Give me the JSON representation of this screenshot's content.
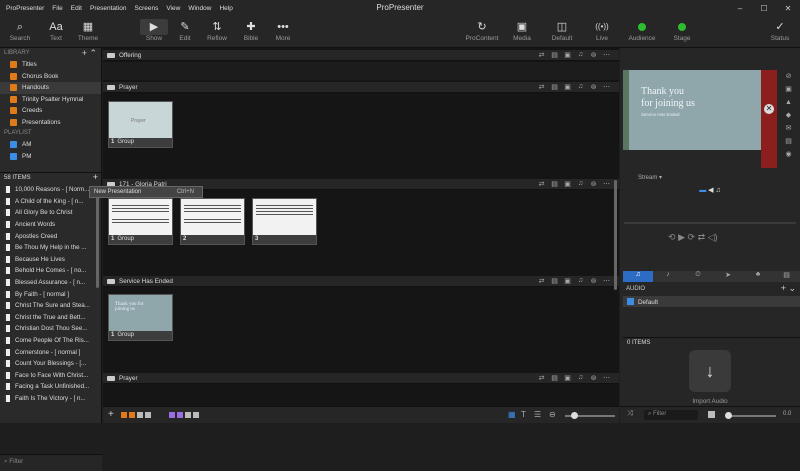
{
  "app": {
    "title": "ProPresenter",
    "menu": [
      "ProPresenter",
      "File",
      "Edit",
      "Presentation",
      "Screens",
      "View",
      "Window",
      "Help"
    ],
    "window_controls": [
      "–",
      "☐",
      "✕"
    ]
  },
  "toolbar": {
    "left": [
      {
        "label": "Search",
        "icon": "search-icon",
        "glyph": "⌕"
      },
      {
        "label": "Text",
        "icon": "text-icon",
        "glyph": "Aa"
      },
      {
        "label": "Theme",
        "icon": "theme-icon",
        "glyph": "▦"
      }
    ],
    "middle": [
      {
        "label": "Show",
        "icon": "show-icon",
        "glyph": "▶"
      },
      {
        "label": "Edit",
        "icon": "edit-icon",
        "glyph": "✎"
      },
      {
        "label": "Reflow",
        "icon": "reflow-icon",
        "glyph": "⇅"
      },
      {
        "label": "Bible",
        "icon": "bible-icon",
        "glyph": "✚"
      },
      {
        "label": "More",
        "icon": "more-icon",
        "glyph": "•••"
      }
    ],
    "right": [
      {
        "label": "ProContent",
        "icon": "procontent-icon",
        "glyph": "↻"
      },
      {
        "label": "Media",
        "icon": "media-icon",
        "glyph": "▣"
      },
      {
        "label": "Default",
        "icon": "default-icon",
        "glyph": "◫"
      },
      {
        "label": "Live",
        "icon": "live-icon",
        "glyph": "((•))"
      },
      {
        "label": "Audience",
        "icon": "audience-dot",
        "glyph": ""
      },
      {
        "label": "Stage",
        "icon": "stage-dot",
        "glyph": ""
      },
      {
        "label": "Status",
        "icon": "status-icon",
        "glyph": "✓"
      }
    ],
    "status_color": "#2ebd2e"
  },
  "library": {
    "header": "LIBRARY",
    "items": [
      "Titles",
      "Chorus Book",
      "Handouts",
      "Trinity Psalter Hymnal",
      "Creeds",
      "Presentations"
    ],
    "selected": "Handouts",
    "playlist_header": "PLAYLIST",
    "playlists": [
      "AM",
      "PM"
    ]
  },
  "items": {
    "count_label": "58 ITEMS",
    "rows": [
      "10,000 Reasons - [ Norm...",
      "A Child of the King - [ n...",
      "All Glory Be to Christ",
      "Ancient Words",
      "Apostles Creed",
      "Be Thou My Help in the ...",
      "Because He Lives",
      "Behold He Comes - [ no...",
      "Blessed Assurance - [ n...",
      "By Faith - [ normal ]",
      "Christ The Sure and Stea...",
      "Christ the True and Bett...",
      "Christian Dost Thou See...",
      "Come People Of The Ris...",
      "Cornerstone - [ normal ]",
      "Count Your Blessings - [...",
      "Face to Face With Christ...",
      "Facing a Task Unfinished...",
      "Faith Is The Victory - [ n..."
    ],
    "filter_placeholder": "Filter"
  },
  "context_menu": {
    "label": "New Presentation",
    "shortcut": "Ctrl+N"
  },
  "sections": [
    {
      "name": "Offering",
      "slides": []
    },
    {
      "name": "Prayer",
      "slides": [
        {
          "num": "1",
          "label": "Group",
          "caption": "Prayer"
        }
      ]
    },
    {
      "name": "171 - Gloria Patri",
      "slides": [
        {
          "num": "1",
          "label": "Group"
        },
        {
          "num": "2",
          "label": ""
        },
        {
          "num": "3",
          "label": ""
        }
      ]
    },
    {
      "name": "Service Has Ended",
      "slides": [
        {
          "num": "1",
          "label": "Group",
          "caption": "Thank you for joining us"
        }
      ]
    },
    {
      "name": "Prayer",
      "slides": []
    }
  ],
  "preview": {
    "line1": "Thank you",
    "line2": "for joining us",
    "sub": "Service Has Ended",
    "stream_label": "Stream"
  },
  "audio": {
    "header": "AUDIO",
    "playlist": "Default",
    "count_label": "0 ITEMS",
    "import_label": "Import Audio",
    "filter_placeholder": "Filter",
    "volume": "0.0"
  }
}
